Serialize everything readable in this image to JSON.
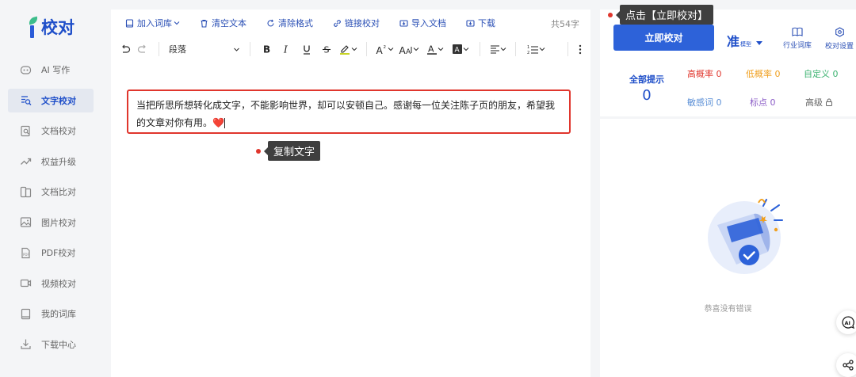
{
  "app": {
    "logo_text": "校对"
  },
  "sidebar": {
    "items": [
      {
        "label": "AI 写作",
        "icon": "ai-write-icon"
      },
      {
        "label": "文字校对",
        "icon": "text-proof-icon",
        "active": true
      },
      {
        "label": "文档校对",
        "icon": "doc-proof-icon"
      },
      {
        "label": "权益升级",
        "icon": "upgrade-icon"
      },
      {
        "label": "文档比对",
        "icon": "doc-compare-icon"
      },
      {
        "label": "图片校对",
        "icon": "image-proof-icon"
      },
      {
        "label": "PDF校对",
        "icon": "pdf-proof-icon"
      },
      {
        "label": "视频校对",
        "icon": "video-proof-icon"
      },
      {
        "label": "我的词库",
        "icon": "dictionary-icon"
      },
      {
        "label": "下载中心",
        "icon": "download-icon"
      }
    ]
  },
  "toolbar": {
    "add_lexicon": "加入词库",
    "clear_text": "清空文本",
    "clear_format": "清除格式",
    "link_proof": "链接校对",
    "import_doc": "导入文档",
    "download": "下载",
    "char_count": "共54字",
    "paragraph_select": "段落"
  },
  "editor": {
    "content": "当把所思所想转化成文字，不能影响世界，却可以安顿自己。感谢每一位关注陈子页的朋友，希望我的文章对你有用。",
    "emoji": "❤️"
  },
  "tips": {
    "copy_text": "复制文字",
    "click_proof": "点击【立即校对】"
  },
  "panel": {
    "proof_button": "立即校对",
    "model_big": "准",
    "model_small": "模型",
    "industry_lexicon": "行业词库",
    "proof_settings": "校对设置",
    "total_label": "全部提示",
    "total_count": "0",
    "high_prob": "高概率 0",
    "low_prob": "低概率 0",
    "custom": "自定义 0",
    "sensitive": "敏感词 0",
    "punctuation": "标点 0",
    "advanced": "高级"
  },
  "result": {
    "message": "恭喜没有错误"
  },
  "colors": {
    "brand": "#2d62d9",
    "highlight_border": "#e0362d",
    "high_prob": "#e0362d",
    "low_prob": "#f0a020",
    "custom": "#3cb371",
    "sensitive": "#5b8fd6",
    "punctuation": "#8b5cc7",
    "advanced": "#666666"
  }
}
